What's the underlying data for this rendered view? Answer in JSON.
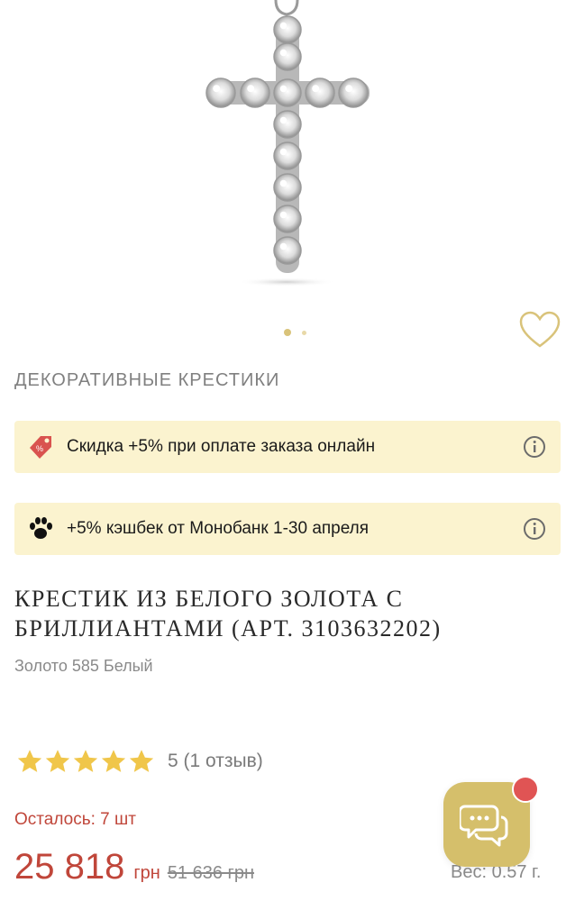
{
  "product": {
    "category": "ДЕКОРАТИВНЫЕ КРЕСТИКИ",
    "title_line1": "КРЕСТИК ИЗ БЕЛОГО ЗОЛОТА С",
    "title_line2": "БРИЛЛИАНТАМИ (АРТ. 3103632202)",
    "material": "Золото 585 Белый",
    "rating_value": 5,
    "rating_text": "5 (1 отзыв)",
    "stock_text": "Осталось: 7 шт",
    "price": "25 818",
    "currency": "грн",
    "old_price": "51 636 грн",
    "weight": "Вес: 0.57 г."
  },
  "gallery": {
    "image_icon": "diamond-cross-pendant",
    "slides_count": 2,
    "active_slide": 1
  },
  "banners": [
    {
      "icon": "discount-tag-icon",
      "text": "Скидка +5% при оплате заказа онлайн"
    },
    {
      "icon": "paw-icon",
      "text": "+5% кэшбек от Монобанк 1-30 апреля"
    }
  ],
  "colors": {
    "accent_gold": "#d5bf6b",
    "banner_bg": "#fbf3cf",
    "price_red": "#c0463a",
    "badge_red": "#e05454",
    "star_yellow": "#f0c64a"
  }
}
